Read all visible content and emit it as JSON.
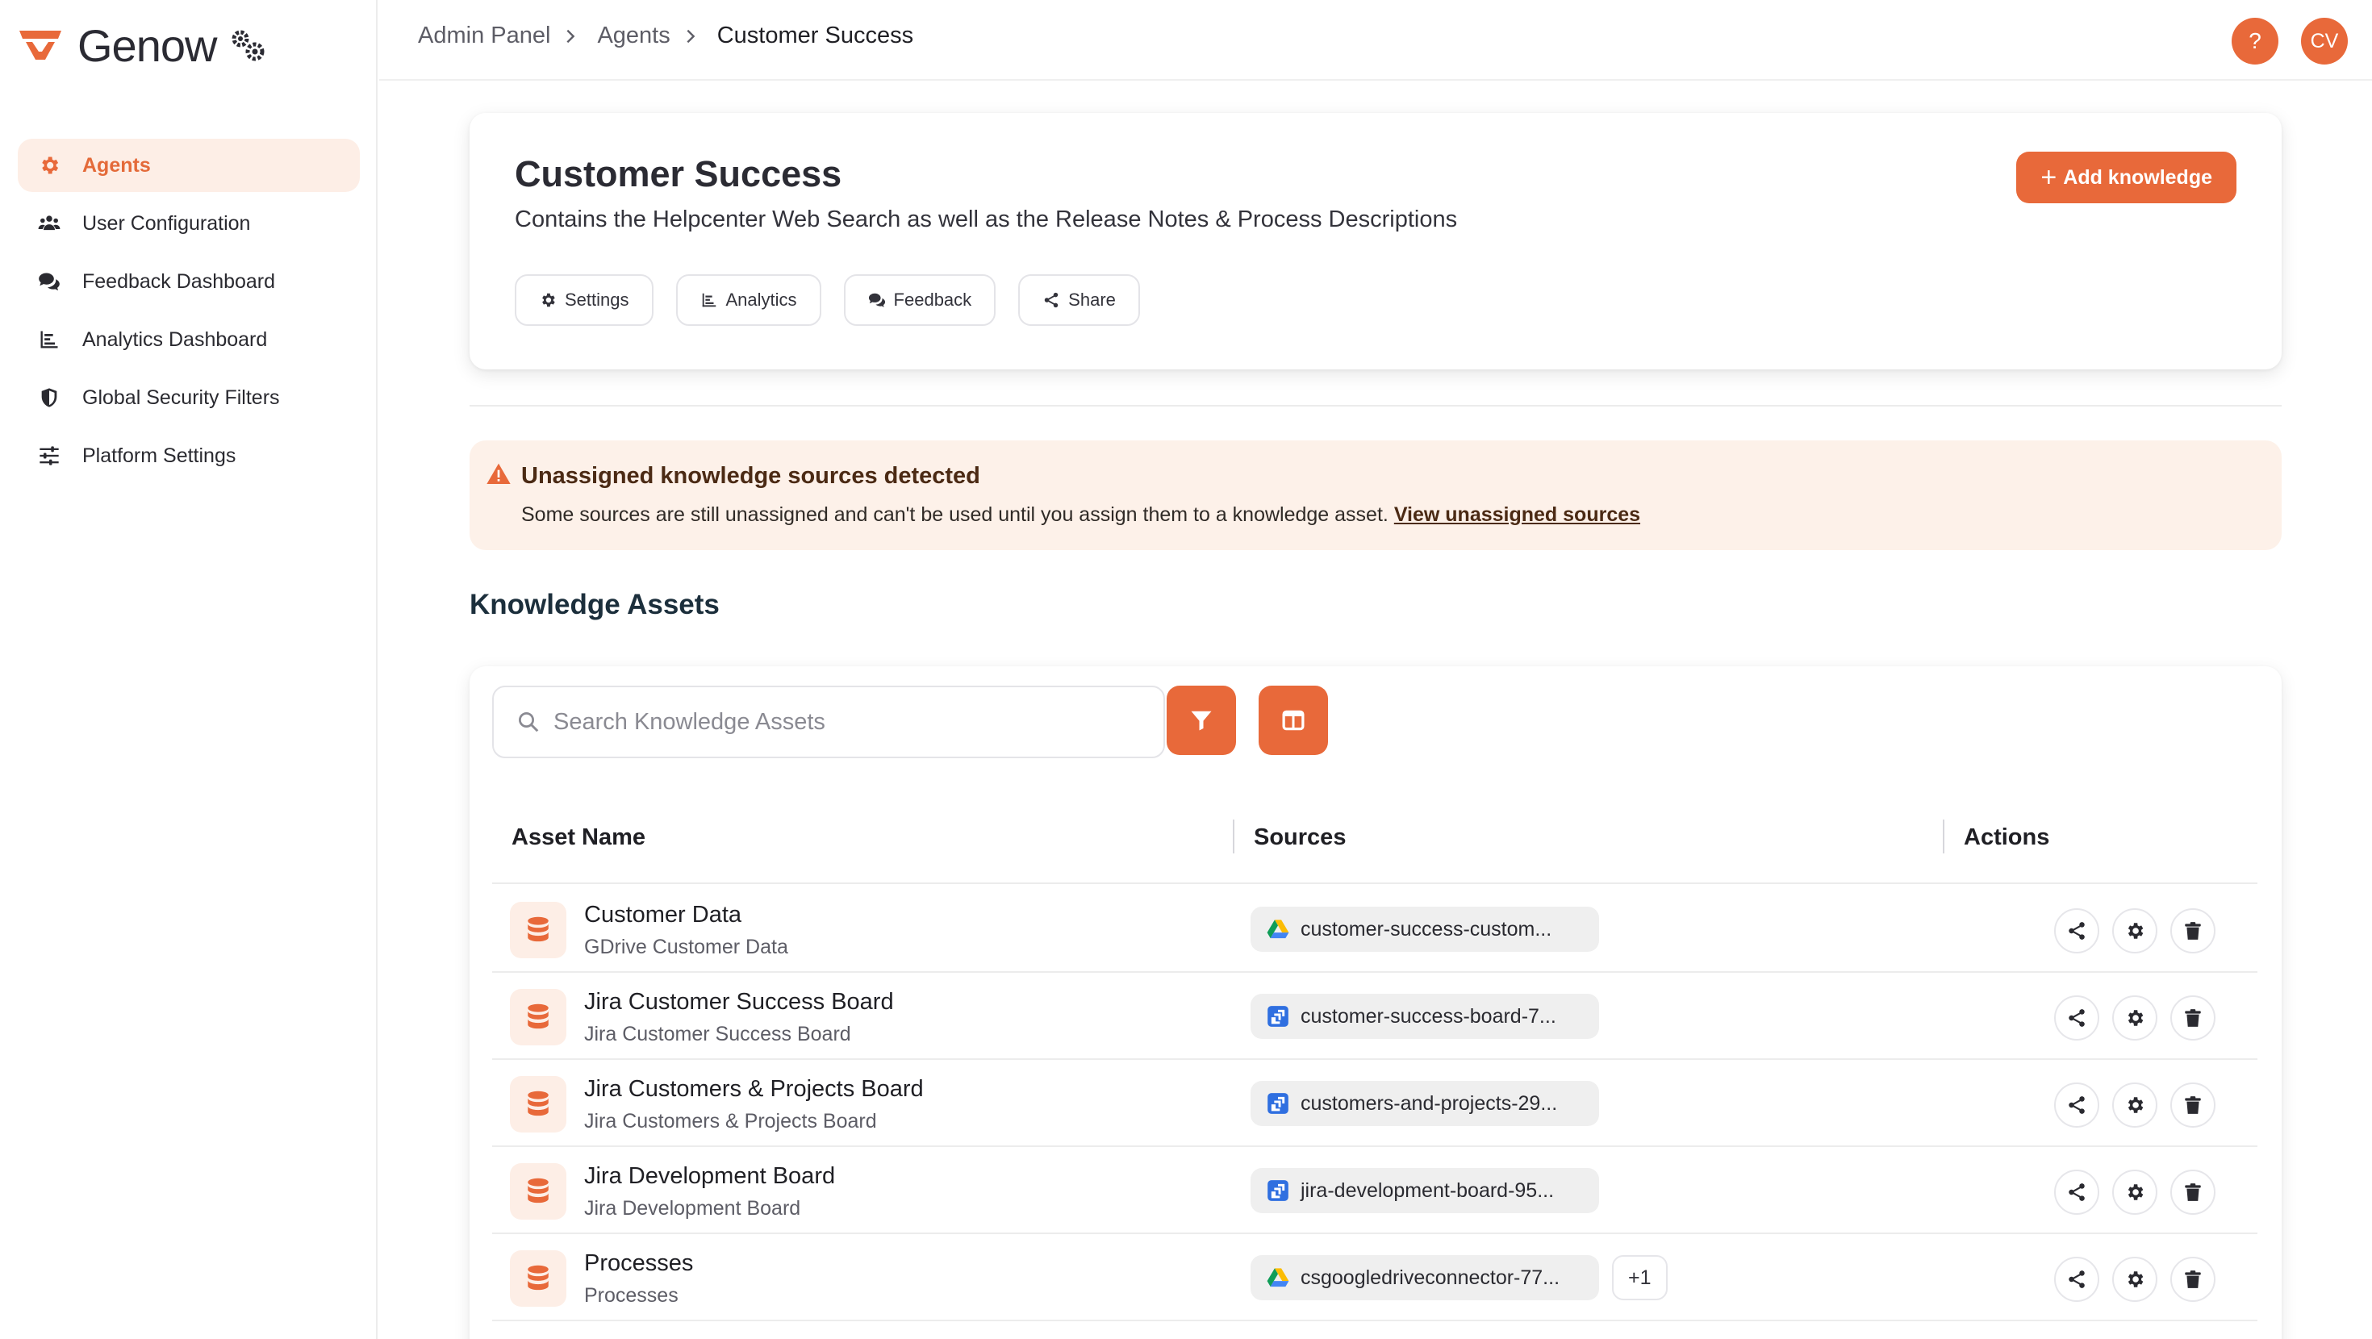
{
  "brand": {
    "name": "Genow",
    "accent": "#e8693a"
  },
  "sidebar": {
    "items": [
      {
        "label": "Agents",
        "icon": "gear-icon",
        "active": true
      },
      {
        "label": "User Configuration",
        "icon": "users-icon"
      },
      {
        "label": "Feedback Dashboard",
        "icon": "comments-icon"
      },
      {
        "label": "Analytics Dashboard",
        "icon": "bar-chart-icon"
      },
      {
        "label": "Global Security Filters",
        "icon": "shield-icon"
      },
      {
        "label": "Platform Settings",
        "icon": "sliders-icon"
      }
    ]
  },
  "topbar": {
    "breadcrumb": [
      "Admin Panel",
      "Agents",
      "Customer Success"
    ],
    "help_label": "?",
    "avatar_initials": "CV"
  },
  "header": {
    "title": "Customer Success",
    "description": "Contains the Helpcenter Web Search as well as the Release Notes & Process Descriptions",
    "add_button": "Add knowledge",
    "add_button_icon": "+",
    "pills": [
      {
        "label": "Settings",
        "icon": "gear-icon"
      },
      {
        "label": "Analytics",
        "icon": "bar-chart-icon"
      },
      {
        "label": "Feedback",
        "icon": "comments-icon"
      },
      {
        "label": "Share",
        "icon": "share-icon"
      }
    ]
  },
  "warning": {
    "title": "Unassigned knowledge sources detected",
    "text": "Some sources are still unassigned and can't be used until you assign them to a knowledge asset. ",
    "link": "View unassigned sources"
  },
  "knowledge": {
    "section_title": "Knowledge Assets",
    "search_placeholder": "Search Knowledge Assets",
    "columns": [
      "Asset Name",
      "Sources",
      "Actions"
    ],
    "rows": [
      {
        "name": "Customer Data",
        "subtitle": "GDrive Customer Data",
        "source": "customer-success-custom...",
        "source_type": "google-drive-icon",
        "extra": ""
      },
      {
        "name": "Jira Customer Success Board",
        "subtitle": "Jira Customer Success Board",
        "source": "customer-success-board-7...",
        "source_type": "jira-icon",
        "extra": ""
      },
      {
        "name": "Jira Customers & Projects Board",
        "subtitle": "Jira Customers & Projects Board",
        "source": "customers-and-projects-29...",
        "source_type": "jira-icon",
        "extra": ""
      },
      {
        "name": "Jira Development Board",
        "subtitle": "Jira Development Board",
        "source": "jira-development-board-95...",
        "source_type": "jira-icon",
        "extra": ""
      },
      {
        "name": "Processes",
        "subtitle": "Processes",
        "source": "csgoogledriveconnector-77...",
        "source_type": "google-drive-icon",
        "extra": "+1"
      }
    ]
  }
}
